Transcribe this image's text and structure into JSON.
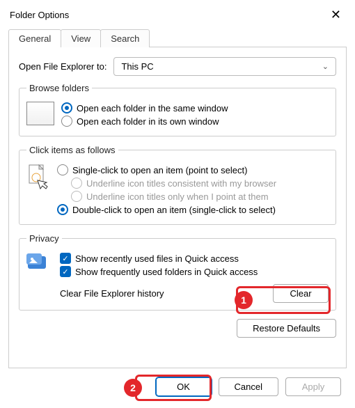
{
  "window": {
    "title": "Folder Options"
  },
  "tabs": {
    "general": "General",
    "view": "View",
    "search": "Search"
  },
  "open_to": {
    "label": "Open File Explorer to:",
    "value": "This PC"
  },
  "browse": {
    "legend": "Browse folders",
    "same_window": "Open each folder in the same window",
    "own_window": "Open each folder in its own window"
  },
  "click": {
    "legend": "Click items as follows",
    "single": "Single-click to open an item (point to select)",
    "underline_browser": "Underline icon titles consistent with my browser",
    "underline_point": "Underline icon titles only when I point at them",
    "double": "Double-click to open an item (single-click to select)"
  },
  "privacy": {
    "legend": "Privacy",
    "recent_files": "Show recently used files in Quick access",
    "frequent_folders": "Show frequently used folders in Quick access",
    "clear_label": "Clear File Explorer history",
    "clear_btn": "Clear"
  },
  "restore_btn": "Restore Defaults",
  "buttons": {
    "ok": "OK",
    "cancel": "Cancel",
    "apply": "Apply"
  },
  "markers": {
    "one": "1",
    "two": "2"
  }
}
